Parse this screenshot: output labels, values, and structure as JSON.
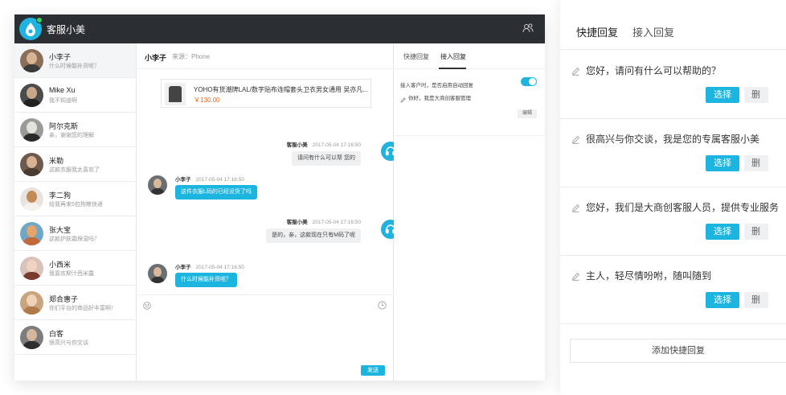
{
  "app": {
    "title": "客服小美"
  },
  "colors": {
    "accent": "#1cb5e0",
    "topbar": "#2b2f33",
    "price": "#e8641b"
  },
  "contacts": [
    {
      "name": "小李子",
      "msg": "什么时候能补货呢？",
      "active": true
    },
    {
      "name": "Mike Xu",
      "msg": "我不知道啊"
    },
    {
      "name": "阿尔克斯",
      "msg": "亲，谢谢您的理解"
    },
    {
      "name": "米勒",
      "msg": "这款衣服我太喜欢了"
    },
    {
      "name": "李二狗",
      "msg": "给我再来5包狗粮快递"
    },
    {
      "name": "张大宝",
      "msg": "这款护肤霜保湿吗？"
    },
    {
      "name": "小西米",
      "msg": "我喜欢柳汁西米露"
    },
    {
      "name": "郑合惠子",
      "msg": "你们平台的商品好丰富啊！"
    },
    {
      "name": "白客",
      "msg": "很高兴与你交谈"
    }
  ],
  "chat": {
    "contact_name": "小李子",
    "source": "来源：Phone",
    "product": {
      "title": "YOHO有货潮牌LAL/数字贴布连帽套头卫衣男女通用 吴亦凡...",
      "price": "￥130.00"
    },
    "messages": [
      {
        "sender": "客服小美",
        "time": "2017-05-04  17:16:50",
        "text": "请问有什么可以帮 您的"
      },
      {
        "sender": "小李子",
        "time": "2017-05-04  17:16:50",
        "text": "这件衣服L码的已经没货了吗"
      },
      {
        "sender": "客服小美",
        "time": "2017-05-04  17:16:50",
        "text": "是的，亲，这款现在只有M码了呢"
      },
      {
        "sender": "小李子",
        "time": "2017-05-04  17:16:50",
        "text": "什么时候能补货呢？"
      }
    ],
    "send_label": "发送"
  },
  "right_panel": {
    "tabs": [
      "快捷回复",
      "接入回复"
    ],
    "auto_reply_label": "接入客户时，是否启用自动回复",
    "auto_reply_on": true,
    "greeting": "你好，我是大商创客服管理",
    "edit_label": "编辑"
  },
  "quick_reply": {
    "tabs": [
      "快捷回复",
      "接入回复"
    ],
    "items": [
      {
        "text": "您好，请问有什么可以帮助的？"
      },
      {
        "text": "很高兴与你交谈，我是您的专属客服小美"
      },
      {
        "text": "您好，我们是大商创客服人员，提供专业服务"
      },
      {
        "text": "主人，轻尽情吩咐，随叫随到"
      }
    ],
    "select_label": "选择",
    "delete_label": "删除",
    "add_label": "添加快捷回复"
  }
}
